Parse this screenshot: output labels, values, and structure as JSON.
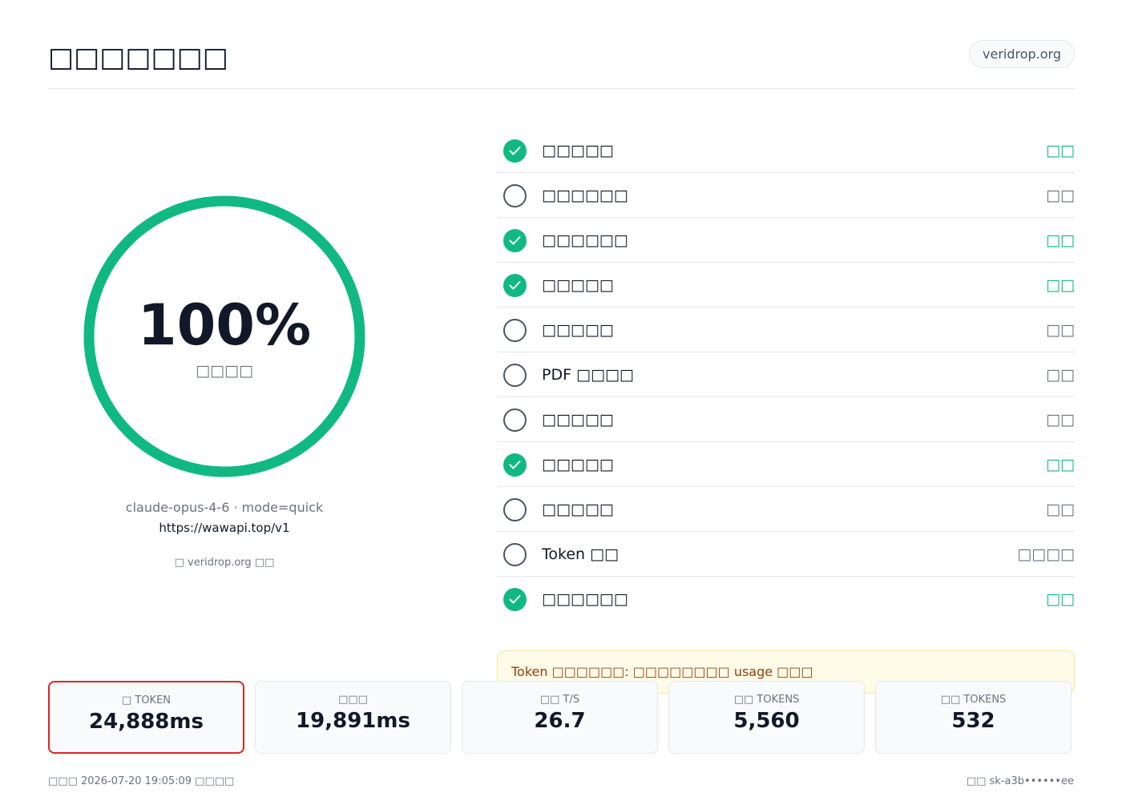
{
  "header": {
    "title": "□□□□□□□",
    "domain": "veridrop.org"
  },
  "score": {
    "value": "100%",
    "label": "□□□□",
    "fraction": 1.0,
    "ring_color": "#10b981"
  },
  "info": {
    "model_line": "claude-opus-4-6  ·  mode=quick",
    "endpoint": "https://wawapi.top/v1",
    "powered_by": "□ veridrop.org □□"
  },
  "checks": [
    {
      "name": "□□□□□",
      "status": "□□",
      "state": "pass"
    },
    {
      "name": "□□□□□□",
      "status": "□□",
      "state": "pending"
    },
    {
      "name": "□□□□□□",
      "status": "□□",
      "state": "pass"
    },
    {
      "name": "□□□□□",
      "status": "□□",
      "state": "pass"
    },
    {
      "name": "□□□□□",
      "status": "□□",
      "state": "pending"
    },
    {
      "name": "PDF □□□□",
      "status": "□□",
      "state": "pending"
    },
    {
      "name": "□□□□□",
      "status": "□□",
      "state": "pending"
    },
    {
      "name": "□□□□□",
      "status": "□□",
      "state": "pass"
    },
    {
      "name": "□□□□□",
      "status": "□□",
      "state": "pending"
    },
    {
      "name": "Token □□",
      "status": "□□□□",
      "state": "pending"
    },
    {
      "name": "□□□□□□",
      "status": "□□",
      "state": "pass"
    }
  ],
  "notice": {
    "text": "Token □□□□□□: □□□□□□□□ usage □□□"
  },
  "stats": [
    {
      "label": "□ TOKEN",
      "value": "24,888ms",
      "highlight": true
    },
    {
      "label": "□□□",
      "value": "19,891ms",
      "highlight": false
    },
    {
      "label": "□□ T/S",
      "value": "26.7",
      "highlight": false
    },
    {
      "label": "□□ TOKENS",
      "value": "5,560",
      "highlight": false
    },
    {
      "label": "□□ TOKENS",
      "value": "532",
      "highlight": false
    }
  ],
  "footer": {
    "left": "□□□ 2026-07-20 19:05:09 □□□□",
    "right": "□□ sk-a3b••••••ee"
  },
  "colors": {
    "pass": "#10b981",
    "highlight_border": "#dc2626",
    "notice_bg": "#fefbe8"
  },
  "icons": {
    "pass": "check-circle-icon",
    "pending": "empty-circle-icon"
  }
}
